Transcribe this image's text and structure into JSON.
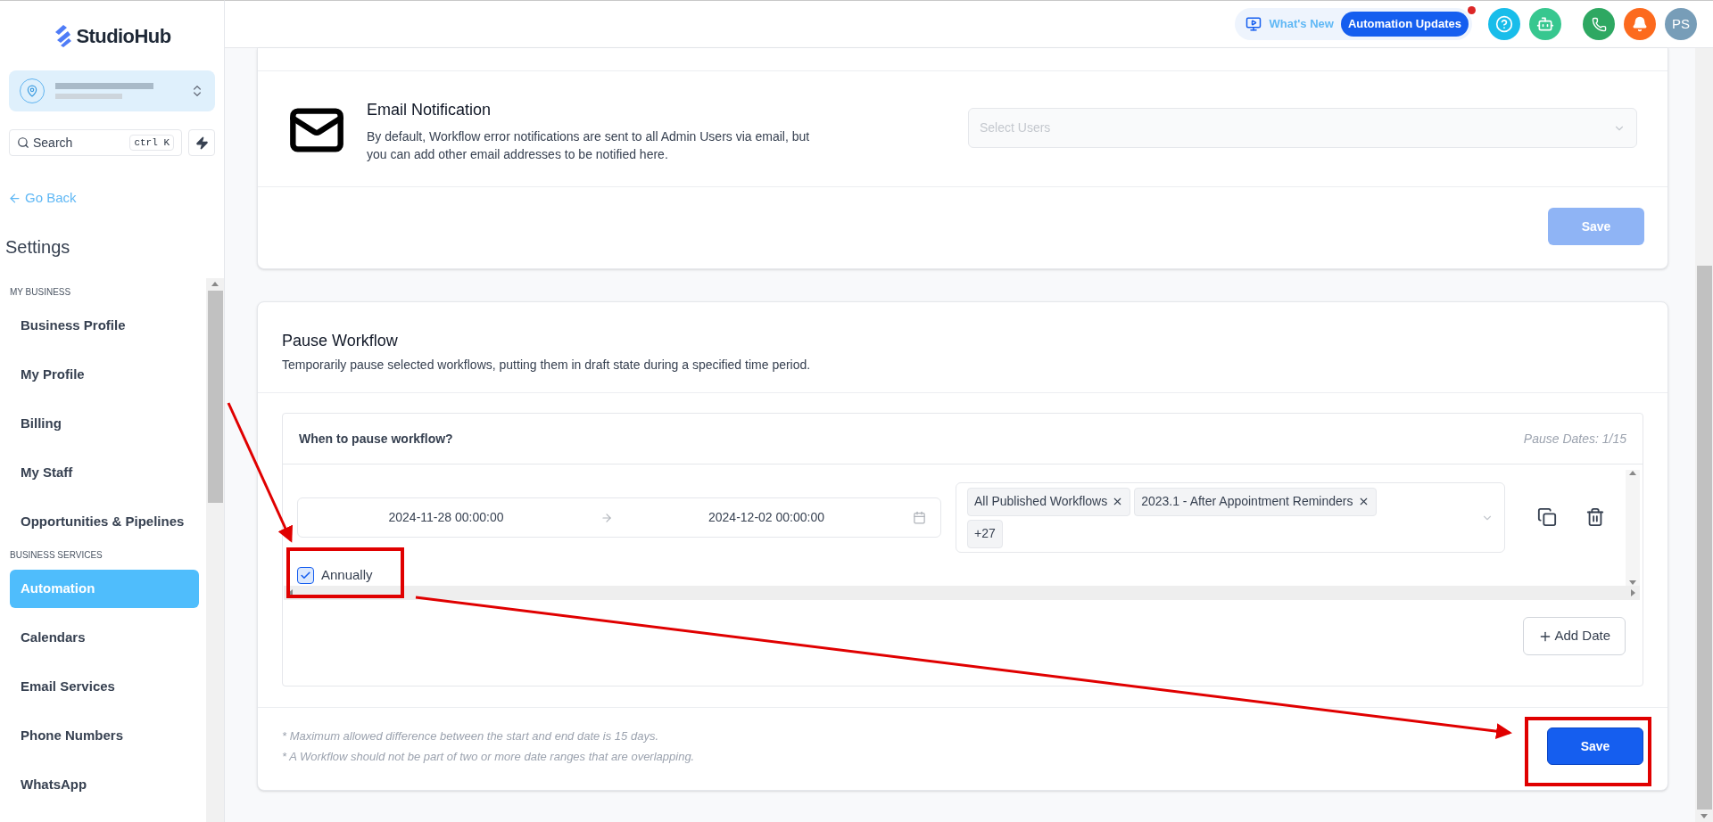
{
  "brand": {
    "name": "StudioHub"
  },
  "sidebar": {
    "search": {
      "placeholder": "Search",
      "shortcut": "ctrl K"
    },
    "back_link": "Go Back",
    "title": "Settings",
    "sections": [
      {
        "heading": "MY BUSINESS",
        "items": [
          {
            "label": "Business Profile",
            "selected": false
          },
          {
            "label": "My Profile",
            "selected": false
          },
          {
            "label": "Billing",
            "selected": false
          },
          {
            "label": "My Staff",
            "selected": false
          },
          {
            "label": "Opportunities & Pipelines",
            "selected": false
          }
        ]
      },
      {
        "heading": "BUSINESS SERVICES",
        "items": [
          {
            "label": "Automation",
            "selected": true
          },
          {
            "label": "Calendars",
            "selected": false
          },
          {
            "label": "Email Services",
            "selected": false
          },
          {
            "label": "Phone Numbers",
            "selected": false
          },
          {
            "label": "WhatsApp",
            "selected": false
          }
        ]
      }
    ]
  },
  "top_bar": {
    "whats_new": "What's New",
    "updates_badge": "Automation Updates",
    "avatar_initials": "PS"
  },
  "email_notification": {
    "title": "Email Notification",
    "description": "By default, Workflow error notifications are sent to all Admin Users via email, but you can add other email addresses to be notified here.",
    "select": {
      "placeholder": "Select Users"
    },
    "save_button": {
      "label": "Save",
      "disabled": true
    }
  },
  "pause_workflow": {
    "title": "Pause Workflow",
    "description": "Temporarily pause selected workflows, putting them in draft state during a specified time period.",
    "panel": {
      "heading": "When to pause workflow?",
      "count": "Pause Dates: 1/15",
      "rows": [
        {
          "start": "2024-11-28 00:00:00",
          "end": "2024-12-02 00:00:00",
          "tags": [
            "All Published Workflows",
            "2023.1 - After Appointment Reminders"
          ],
          "more": "+27",
          "annually": {
            "label": "Annually",
            "checked": true
          }
        }
      ],
      "add_button": "Add Date"
    },
    "notes": [
      "* Maximum allowed difference between the start and end date is 15 days.",
      "* A Workflow should not be part of two or more date ranges that are overlapping."
    ],
    "save_button": {
      "label": "Save",
      "disabled": false
    }
  }
}
